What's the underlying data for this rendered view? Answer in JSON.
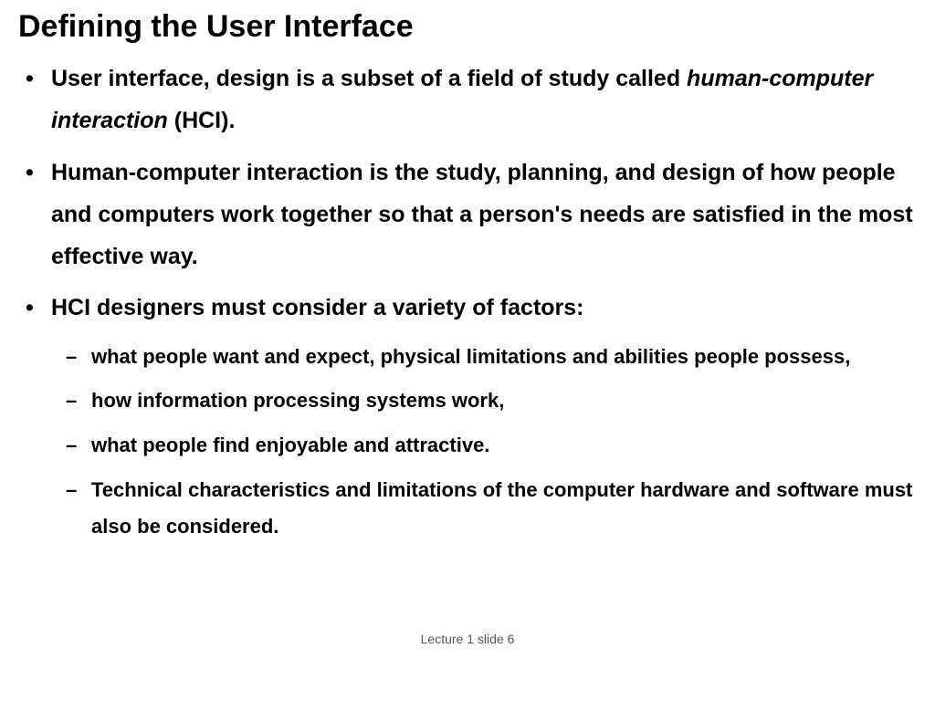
{
  "title": "Defining the User Interface",
  "bullets": {
    "b1_pre": "User interface, design is a subset of a field of study called ",
    "b1_italic": "human-computer interaction",
    "b1_post": " (HCI).",
    "b2": "Human-computer interaction is the study, planning, and design of how people and computers work together so that a person's needs are satisfied in the most effective way.",
    "b3": "HCI designers must consider a variety of factors:",
    "sub": {
      "s1": "what people want and expect, physical limitations and abilities people possess,",
      "s2": "how information processing systems work,",
      "s3": "what people find enjoyable and attractive.",
      "s4": "Technical characteristics and limitations of the computer hardware and software must also be considered."
    }
  },
  "footer": "Lecture 1 slide 6"
}
